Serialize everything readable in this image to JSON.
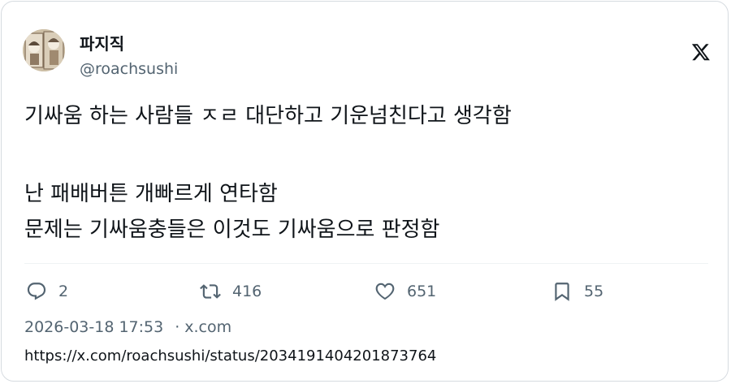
{
  "author": {
    "name": "파지직",
    "handle": "@roachsushi",
    "avatar_icon": "comic-avatar"
  },
  "brand_icon": "x-logo-icon",
  "tweet": {
    "lines": [
      "기싸움 하는 사람들 ㅈㄹ 대단하고 기운넘친다고 생각함",
      "난 패배버튼 개빠르게 연타함",
      "문제는 기싸움충들은 이것도 기싸움으로 판정함"
    ]
  },
  "actions": {
    "reply_count": "2",
    "retweet_count": "416",
    "like_count": "651",
    "bookmark_count": "55"
  },
  "meta": {
    "timestamp": "2026-03-18 17:53",
    "separator": "·",
    "source": "x.com"
  },
  "url": "https://x.com/roachsushi/status/2034191404201873764",
  "colors": {
    "text": "#0f1419",
    "secondary": "#536471",
    "border": "#d6dbe0"
  }
}
